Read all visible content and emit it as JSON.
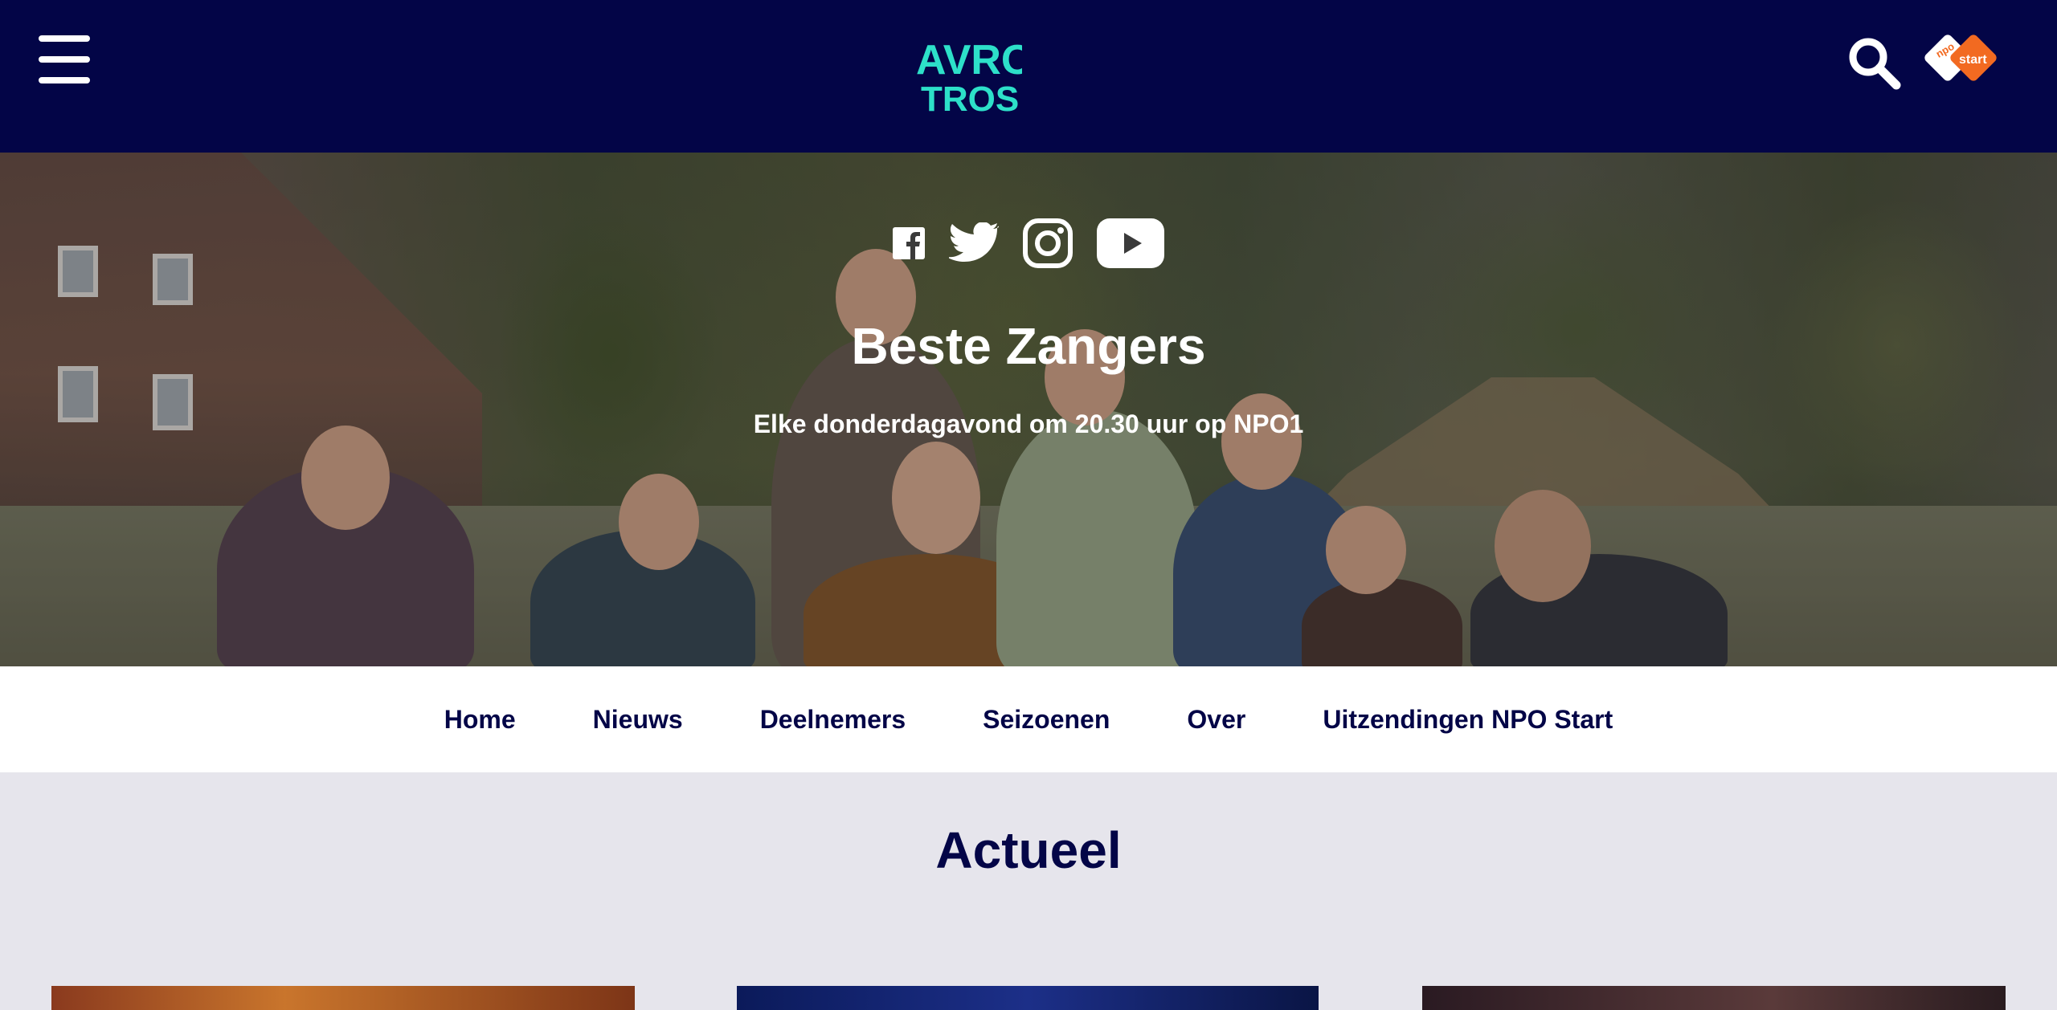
{
  "header": {
    "menu_icon": "hamburger-menu-icon",
    "logo_lines": [
      "AVRO",
      "TROS"
    ],
    "search_icon": "search-icon",
    "npo_start_label": "start",
    "npo_label": "npo",
    "brand_color": "#030547",
    "logo_color": "#2de0c9",
    "npo_orange": "#f26a21"
  },
  "hero": {
    "social": [
      {
        "name": "facebook-icon"
      },
      {
        "name": "twitter-icon"
      },
      {
        "name": "instagram-icon"
      },
      {
        "name": "youtube-icon"
      }
    ],
    "title": "Beste Zangers",
    "subtitle": "Elke donderdagavond om 20.30 uur op NPO1"
  },
  "nav": {
    "items": [
      "Home",
      "Nieuws",
      "Deelnemers",
      "Seizoenen",
      "Over",
      "Uitzendingen NPO Start"
    ]
  },
  "main": {
    "section_title": "Actueel"
  }
}
